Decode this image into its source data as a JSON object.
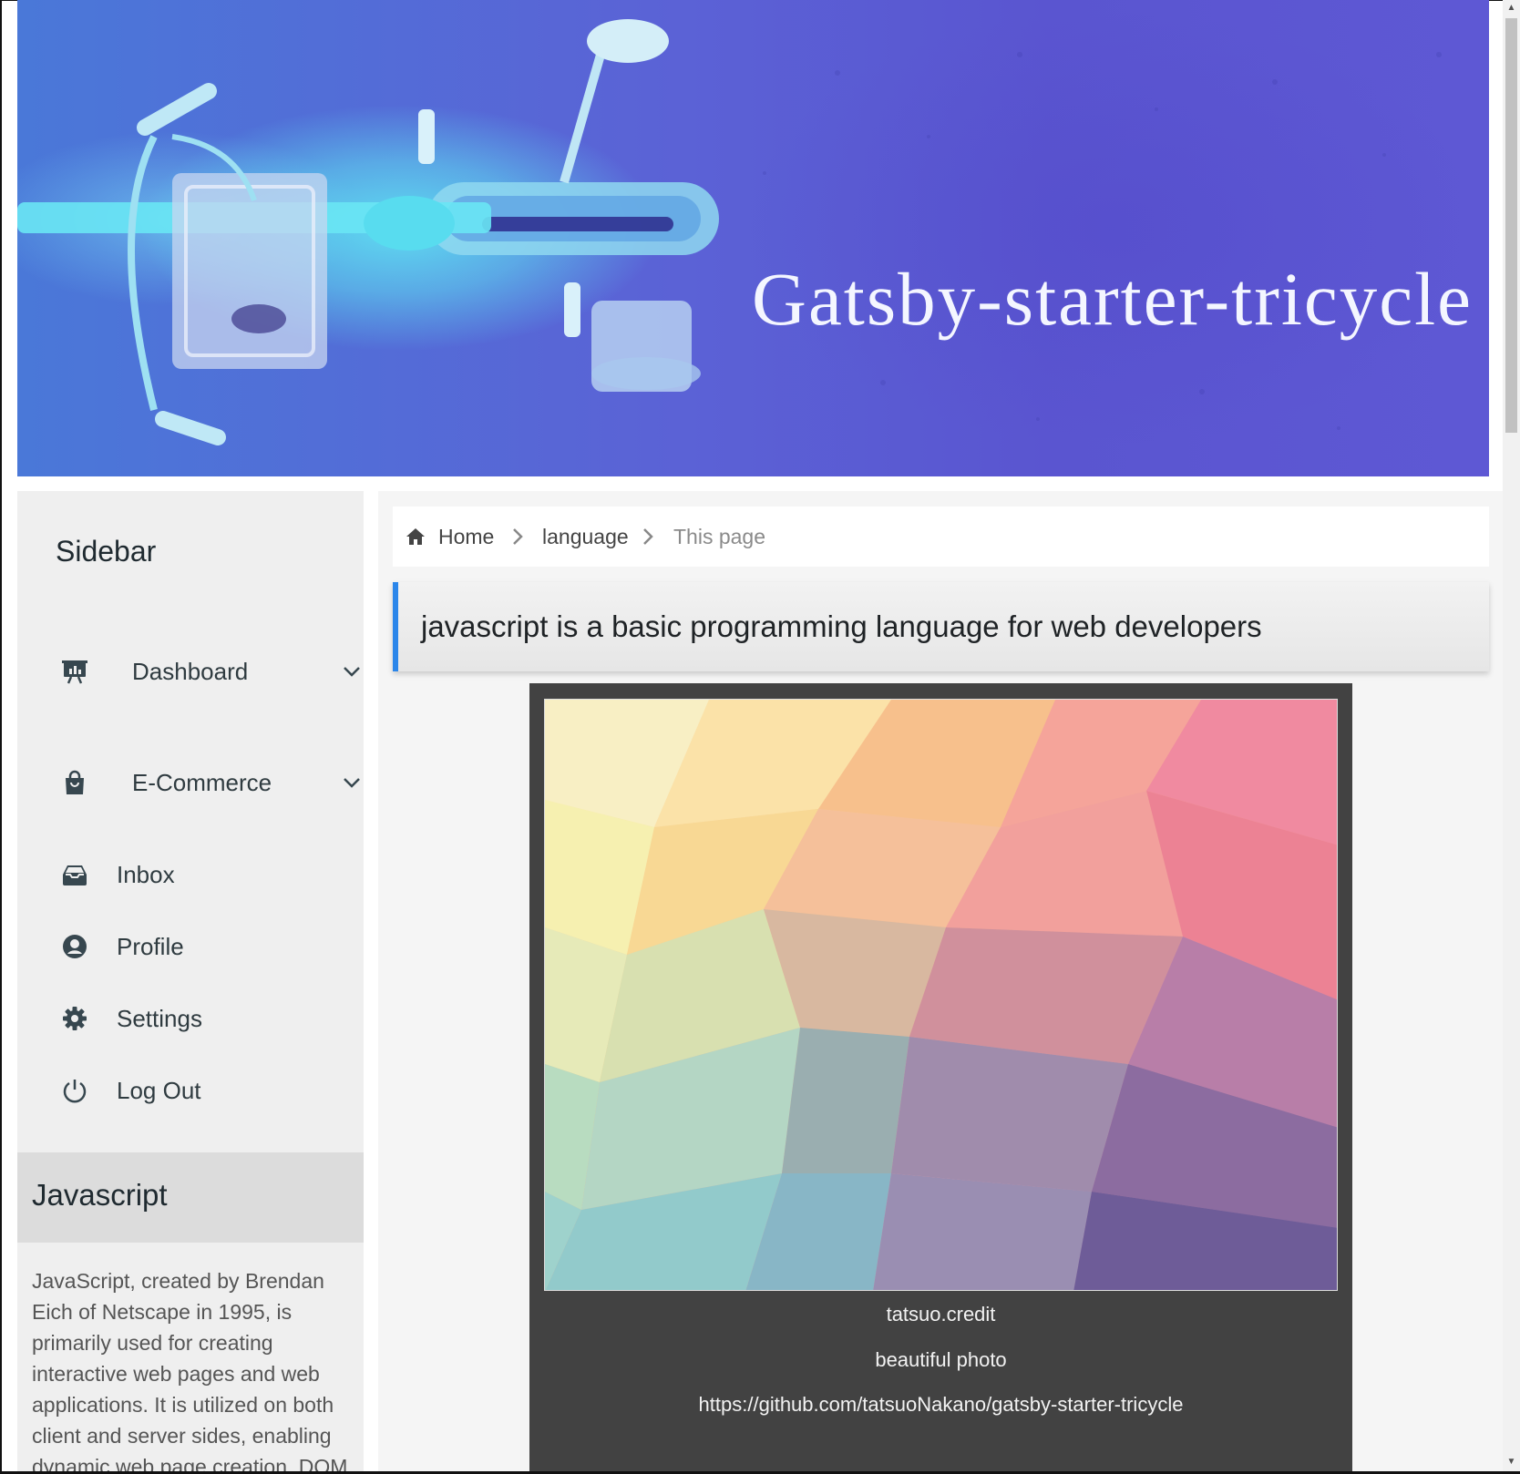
{
  "banner": {
    "title": "Gatsby-starter-tricycle"
  },
  "sidebar": {
    "title": "Sidebar",
    "items": [
      {
        "label": "Dashboard",
        "icon": "presentation-chart-icon",
        "expandable": true
      },
      {
        "label": "E-Commerce",
        "icon": "shopping-bag-icon",
        "expandable": true
      },
      {
        "label": "Inbox",
        "icon": "inbox-icon",
        "expandable": false
      },
      {
        "label": "Profile",
        "icon": "user-circle-icon",
        "expandable": false
      },
      {
        "label": "Settings",
        "icon": "gear-icon",
        "expandable": false
      },
      {
        "label": "Log Out",
        "icon": "power-icon",
        "expandable": false
      }
    ],
    "topic": {
      "title": "Javascript",
      "text": "JavaScript, created by Brendan Eich of Netscape in 1995, is primarily used for creating interactive web pages and web applications. It is utilized on both client and server sides, enabling dynamic web page creation, DOM"
    }
  },
  "breadcrumb": {
    "home": "Home",
    "section": "language",
    "current": "This page"
  },
  "headline": "javascript is a basic programming language for web developers",
  "card": {
    "credit": "tatsuo.credit",
    "description": "beautiful photo",
    "link": "https://github.com/tatsuoNakano/gatsby-starter-tricycle"
  },
  "colors": {
    "accent": "#2b86ea",
    "banner": "#5a5fd4",
    "card": "#424242",
    "sidebar": "#efefef"
  }
}
